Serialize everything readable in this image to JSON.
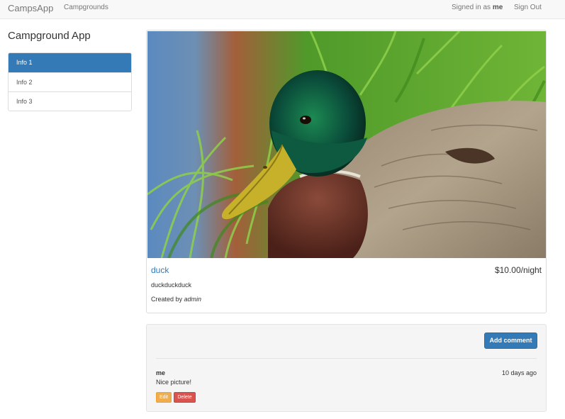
{
  "navbar": {
    "brand": "CampsApp",
    "campgrounds_link": "Campgrounds",
    "signed_in_prefix": "Signed in as ",
    "signed_in_user": "me",
    "signout_link": "Sign Out"
  },
  "sidebar": {
    "title": "Campground App",
    "items": [
      {
        "label": "Info 1",
        "active": true
      },
      {
        "label": "Info 2",
        "active": false
      },
      {
        "label": "Info 3",
        "active": false
      }
    ]
  },
  "campground": {
    "name": "duck",
    "price": "$10.00/night",
    "description": "duckduckduck",
    "created_by_prefix": "Created by ",
    "author": "admin"
  },
  "comments": {
    "add_button": "Add comment",
    "items": [
      {
        "author": "me",
        "time": "10 days ago",
        "text": "Nice picture!",
        "edit_label": "Edit",
        "delete_label": "Delete"
      }
    ]
  },
  "colors": {
    "primary": "#337ab7",
    "warning": "#f0ad4e",
    "danger": "#d9534f",
    "navbar_bg": "#f8f8f8",
    "well_bg": "#f5f5f5"
  }
}
